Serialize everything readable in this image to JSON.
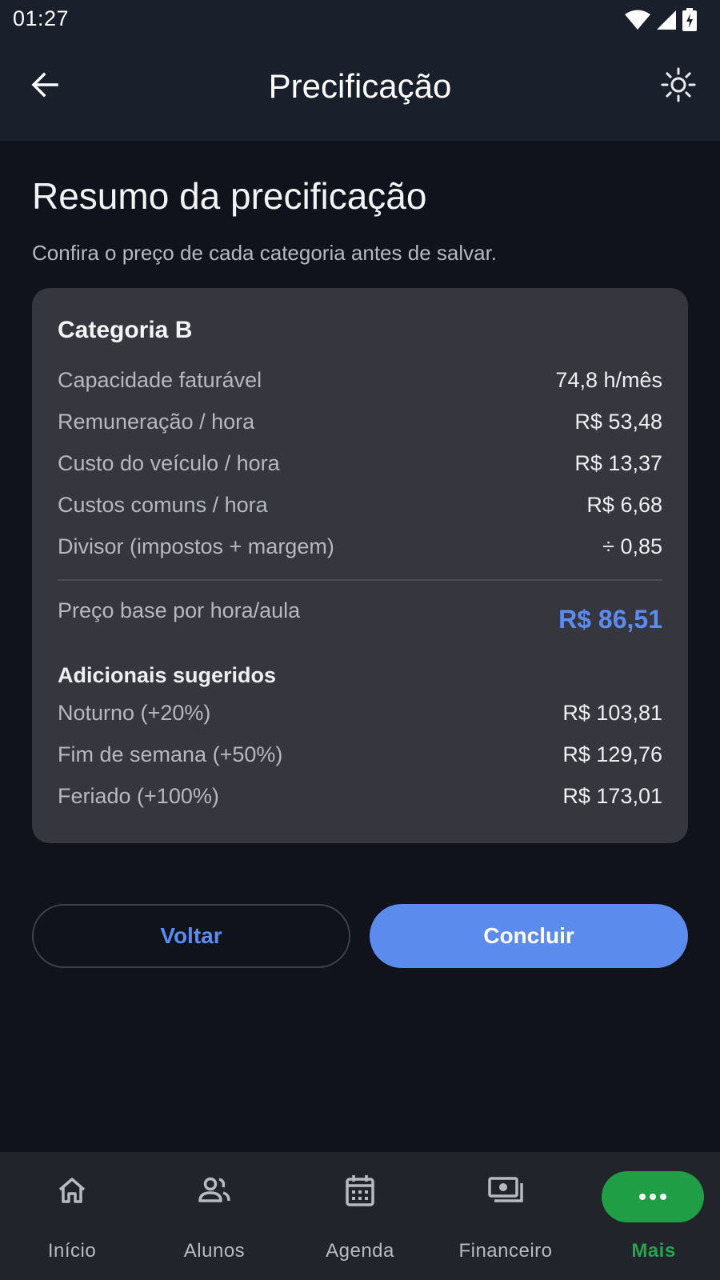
{
  "status_bar": {
    "time": "01:27"
  },
  "app_bar": {
    "title": "Precificação"
  },
  "page": {
    "heading": "Resumo da precificação",
    "subtitle": "Confira o preço de cada categoria antes de salvar."
  },
  "card": {
    "category": "Categoria B",
    "rows": [
      {
        "label": "Capacidade faturável",
        "value": "74,8 h/mês"
      },
      {
        "label": "Remuneração / hora",
        "value": "R$ 53,48"
      },
      {
        "label": "Custo do veículo / hora",
        "value": "R$ 13,37"
      },
      {
        "label": "Custos comuns / hora",
        "value": "R$ 6,68"
      },
      {
        "label": "Divisor (impostos + margem)",
        "value": "÷ 0,85"
      }
    ],
    "base_price": {
      "label": "Preço base por hora/aula",
      "value": "R$ 86,51"
    },
    "additionals_title": "Adicionais sugeridos",
    "additionals": [
      {
        "label": "Noturno (+20%)",
        "value": "R$ 103,81"
      },
      {
        "label": "Fim de semana (+50%)",
        "value": "R$ 129,76"
      },
      {
        "label": "Feriado (+100%)",
        "value": "R$ 173,01"
      }
    ]
  },
  "actions": {
    "back_label": "Voltar",
    "finish_label": "Concluir"
  },
  "bottom_nav": {
    "items": [
      {
        "label": "Início",
        "icon": "home-icon"
      },
      {
        "label": "Alunos",
        "icon": "people-icon"
      },
      {
        "label": "Agenda",
        "icon": "calendar-icon"
      },
      {
        "label": "Financeiro",
        "icon": "money-icon"
      },
      {
        "label": "Mais",
        "icon": "more-icon"
      }
    ],
    "active": "Mais"
  },
  "colors": {
    "accent": "#5b8bed",
    "active_nav": "#1f9e45",
    "background": "#10131b",
    "card": "#36363e"
  }
}
